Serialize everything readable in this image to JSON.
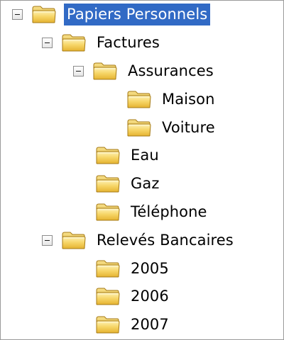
{
  "tree": {
    "nodes": [
      {
        "label": "Papiers Personnels",
        "expanded": true,
        "selected": true
      },
      {
        "label": "Factures",
        "expanded": true
      },
      {
        "label": "Assurances",
        "expanded": true
      },
      {
        "label": "Maison"
      },
      {
        "label": "Voiture"
      },
      {
        "label": "Eau"
      },
      {
        "label": "Gaz"
      },
      {
        "label": "Téléphone"
      },
      {
        "label": "Relevés Bancaires",
        "expanded": true
      },
      {
        "label": "2005"
      },
      {
        "label": "2006"
      },
      {
        "label": "2007"
      }
    ]
  },
  "colors": {
    "selection": "#316ac5",
    "folder": "#f3cd4e"
  },
  "icons": {
    "folder": "folder-icon",
    "collapse": "collapse-icon"
  }
}
